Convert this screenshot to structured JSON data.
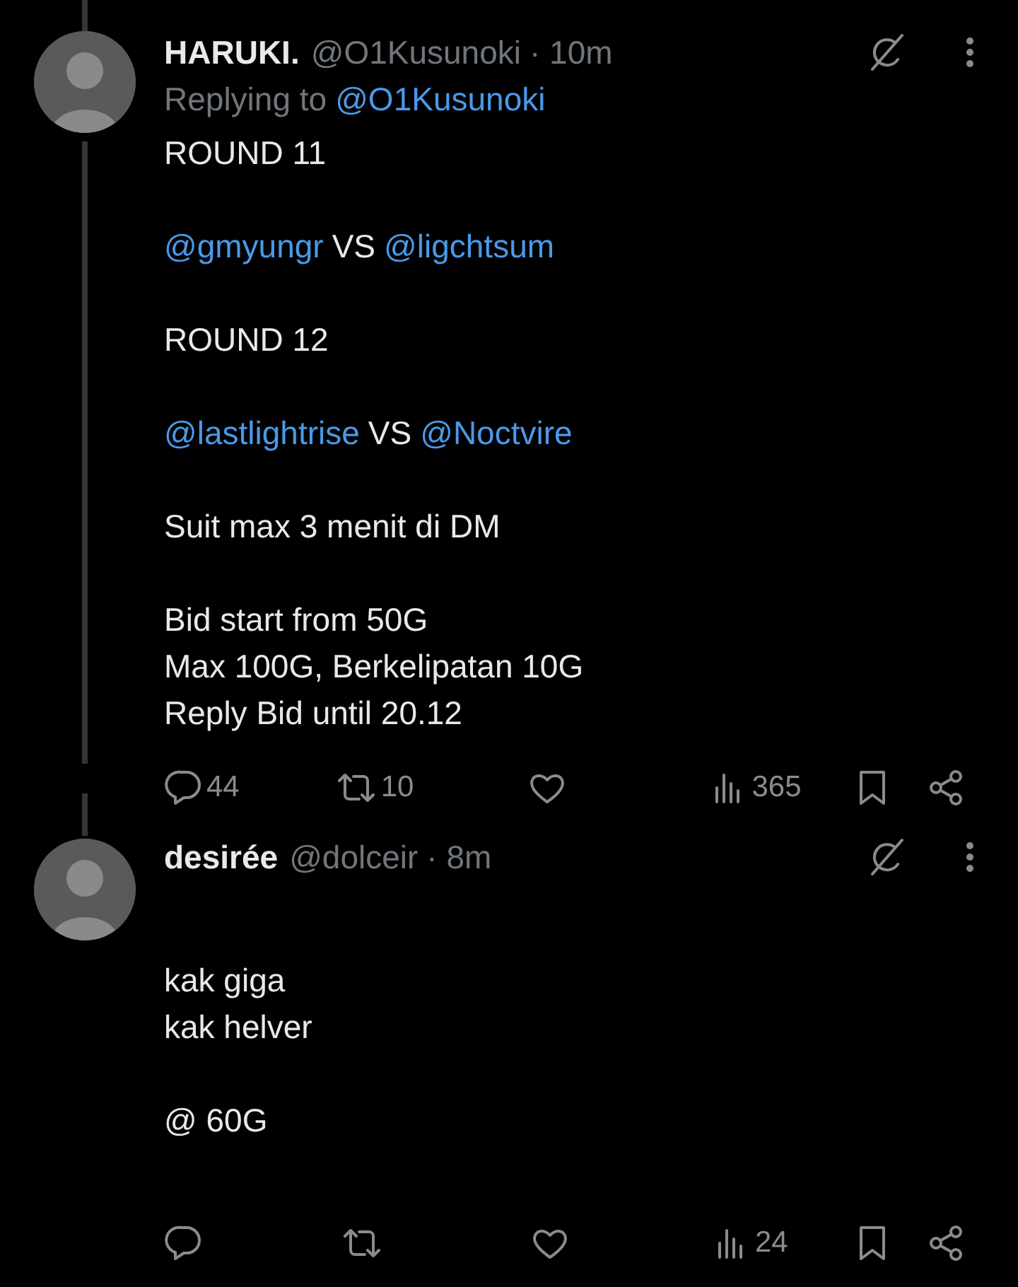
{
  "tweets": [
    {
      "name": "HARUKI.",
      "handle": "@O1Kusunoki",
      "time": "· 10m",
      "replying_to": {
        "label": "Replying to",
        "handle": "@O1Kusunoki"
      },
      "thread_line_above": true,
      "thread_line_below": true,
      "paragraphs": [
        [
          [
            {
              "kind": "text",
              "text": "ROUND 11"
            }
          ]
        ],
        [
          [
            {
              "kind": "mention",
              "text": "@gmyungr"
            },
            {
              "kind": "text",
              "text": "VS"
            },
            {
              "kind": "mention",
              "text": "@ligchtsum"
            }
          ]
        ],
        [
          [
            {
              "kind": "text",
              "text": "ROUND 12"
            }
          ]
        ],
        [
          [
            {
              "kind": "mention",
              "text": "@lastlightrise"
            },
            {
              "kind": "text",
              "text": "VS"
            },
            {
              "kind": "mention",
              "text": "@Noctvire"
            }
          ]
        ],
        [
          [
            {
              "kind": "text",
              "text": "Suit max 3 menit di DM"
            }
          ]
        ],
        [
          [
            {
              "kind": "text",
              "text": "Bid start from 50G"
            }
          ],
          [
            {
              "kind": "text",
              "text": "Max 100G, Berkelipatan 10G"
            }
          ],
          [
            {
              "kind": "text",
              "text": "Reply Bid until 20.12"
            }
          ]
        ]
      ],
      "actions": {
        "replies": "44",
        "reposts": "10",
        "views": "365"
      }
    },
    {
      "name": "desirée",
      "handle": "@dolceir",
      "time": "· 8m",
      "thread_line_above": true,
      "thread_line_below": false,
      "paragraphs": [
        [
          [
            {
              "kind": "text",
              "text": "kak giga"
            }
          ],
          [
            {
              "kind": "text",
              "text": "kak helver"
            }
          ]
        ],
        [
          [
            {
              "kind": "text",
              "text": "@ 60G"
            }
          ]
        ]
      ],
      "actions": {
        "views": "24"
      }
    }
  ]
}
